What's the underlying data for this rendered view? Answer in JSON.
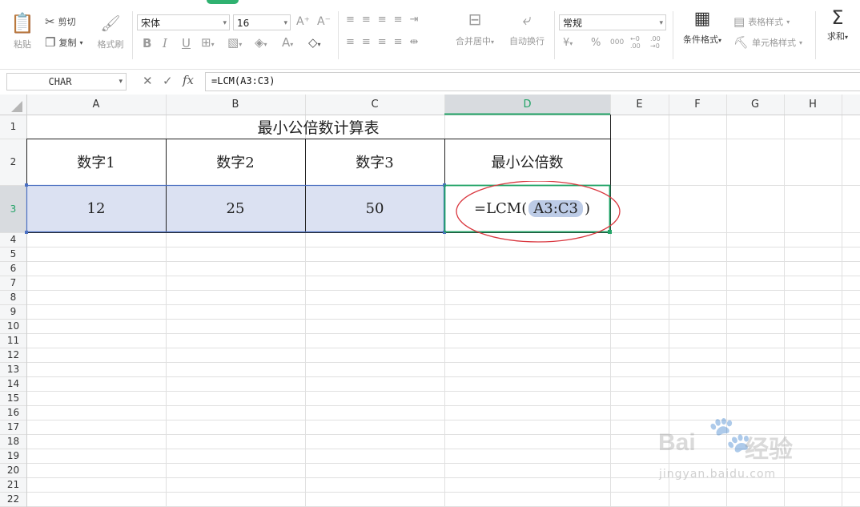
{
  "ribbon": {
    "paste_label": "粘贴",
    "cut_label": "剪切",
    "copy_label": "复制",
    "format_painter_label": "格式刷",
    "font_name": "宋体",
    "font_size": "16",
    "bold": "B",
    "italic": "I",
    "underline": "U",
    "font_grow": "A⁺",
    "font_shrink": "A⁻",
    "merge_center_label": "合并居中",
    "wrap_text_label": "自动换行",
    "number_format": "常规",
    "currency": "¥",
    "percent": "%",
    "thousands": "000",
    "inc_decimal": "←0 .00",
    "dec_decimal": ".00 →0",
    "cond_format_label": "条件格式",
    "table_style_label": "表格样式",
    "cell_style_label": "单元格样式",
    "sum_label": "求和"
  },
  "formula_bar": {
    "name_box": "CHAR",
    "fx_label": "fx",
    "formula": "=LCM(A3:C3)"
  },
  "columns": [
    "A",
    "B",
    "C",
    "D",
    "E",
    "F",
    "G",
    "H"
  ],
  "rows": [
    "1",
    "2",
    "3",
    "4",
    "5",
    "6",
    "7",
    "8",
    "9",
    "10",
    "11",
    "12",
    "13",
    "14",
    "15",
    "16",
    "17",
    "18",
    "19",
    "20",
    "21",
    "22"
  ],
  "sheet": {
    "title": "最小公倍数计算表",
    "headers": [
      "数字1",
      "数字2",
      "数字3",
      "最小公倍数"
    ],
    "values": [
      "12",
      "25",
      "50"
    ],
    "edit_prefix": "=LCM(",
    "edit_range": "A3:C3",
    "edit_suffix": ")"
  },
  "watermark": {
    "brand": "Bai",
    "brand_cn": "经验",
    "url": "jingyan.baidu.com"
  },
  "colors": {
    "selection_fill": "#dbe1f2",
    "active_cell_border": "#21a366",
    "range_highlight": "#bccbe6",
    "annotation_red": "#d9363e",
    "header_active": "#d5d8dc"
  }
}
